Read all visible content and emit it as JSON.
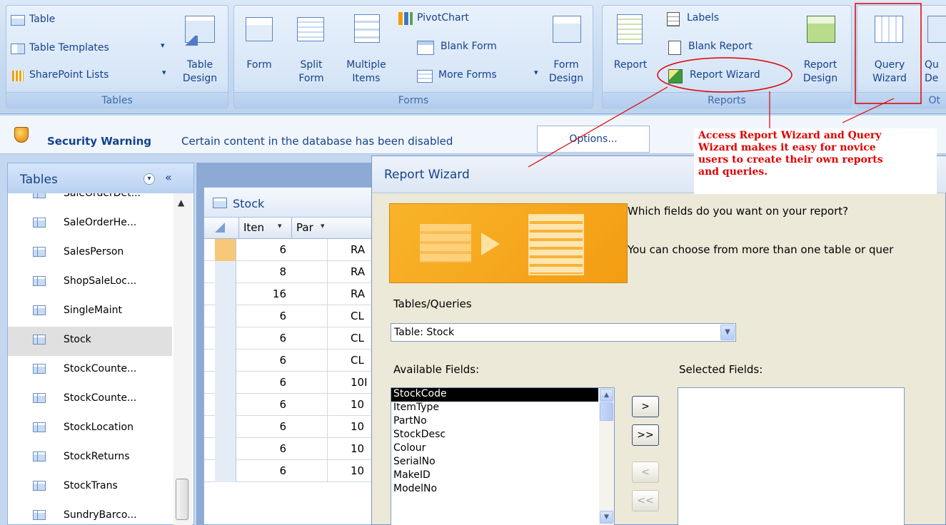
{
  "ribbon": {
    "tables": {
      "table": "Table",
      "table_templates": "Table Templates",
      "sharepoint_lists": "SharePoint Lists",
      "table_design": "Table\nDesign",
      "group_label": "Tables"
    },
    "forms": {
      "form": "Form",
      "split_form": "Split\nForm",
      "multiple_items": "Multiple\nItems",
      "pivotchart": "PivotChart",
      "blank_form": "Blank Form",
      "more_forms": "More Forms",
      "form_design": "Form\nDesign",
      "group_label": "Forms"
    },
    "reports": {
      "report": "Report",
      "labels": "Labels",
      "blank_report": "Blank Report",
      "report_wizard": "Report Wizard",
      "report_design": "Report\nDesign",
      "group_label": "Reports"
    },
    "other": {
      "query_wizard": "Query\nWizard",
      "query_design_partial": "Qu\nDe",
      "group_label_partial": "Ot"
    }
  },
  "security_bar": {
    "title": "Security Warning",
    "message": "Certain content in the database has been disabled",
    "options_button": "Options..."
  },
  "nav_pane": {
    "header": "Tables",
    "items": [
      {
        "label": "SaleOrderDet...",
        "selected": false
      },
      {
        "label": "SaleOrderHe...",
        "selected": false
      },
      {
        "label": "SalesPerson",
        "selected": false
      },
      {
        "label": "ShopSaleLoc...",
        "selected": false
      },
      {
        "label": "SingleMaint",
        "selected": false
      },
      {
        "label": "Stock",
        "selected": true
      },
      {
        "label": "StockCounte...",
        "selected": false
      },
      {
        "label": "StockCounte...",
        "selected": false
      },
      {
        "label": "StockLocation",
        "selected": false
      },
      {
        "label": "StockReturns",
        "selected": false
      },
      {
        "label": "StockTrans",
        "selected": false
      },
      {
        "label": "SundryBarco...",
        "selected": false
      }
    ]
  },
  "datasheet": {
    "tab": "Stock",
    "columns": [
      "Iten",
      "Par"
    ],
    "rows": [
      {
        "item": "6",
        "part": "RA"
      },
      {
        "item": "8",
        "part": "RA"
      },
      {
        "item": "16",
        "part": "RA"
      },
      {
        "item": "6",
        "part": "CL"
      },
      {
        "item": "6",
        "part": "CL"
      },
      {
        "item": "6",
        "part": "CL"
      },
      {
        "item": "6",
        "part": "10I"
      },
      {
        "item": "6",
        "part": "10"
      },
      {
        "item": "6",
        "part": "10"
      },
      {
        "item": "6",
        "part": "10"
      },
      {
        "item": "6",
        "part": "10"
      }
    ]
  },
  "wizard": {
    "title": "Report Wizard",
    "question": "Which fields do you want on your report?",
    "hint": "You can choose from more than one table or quer",
    "tables_queries_label": "Tables/Queries",
    "tables_queries_value": "Table: Stock",
    "available_label": "Available Fields:",
    "selected_label": "Selected Fields:",
    "available_fields": [
      "StockCode",
      "ItemType",
      "PartNo",
      "StockDesc",
      "Colour",
      "SerialNo",
      "MakeID",
      "ModelNo"
    ],
    "selected_fields": [],
    "buttons": {
      "add": ">",
      "add_all": ">>",
      "remove": "<",
      "remove_all": "<<"
    }
  },
  "annotation": {
    "lines": [
      "Access Report Wizard and Query",
      "Wizard makes it easy for novice",
      "users to create their own reports",
      "and queries."
    ],
    "color": "#e00000"
  }
}
